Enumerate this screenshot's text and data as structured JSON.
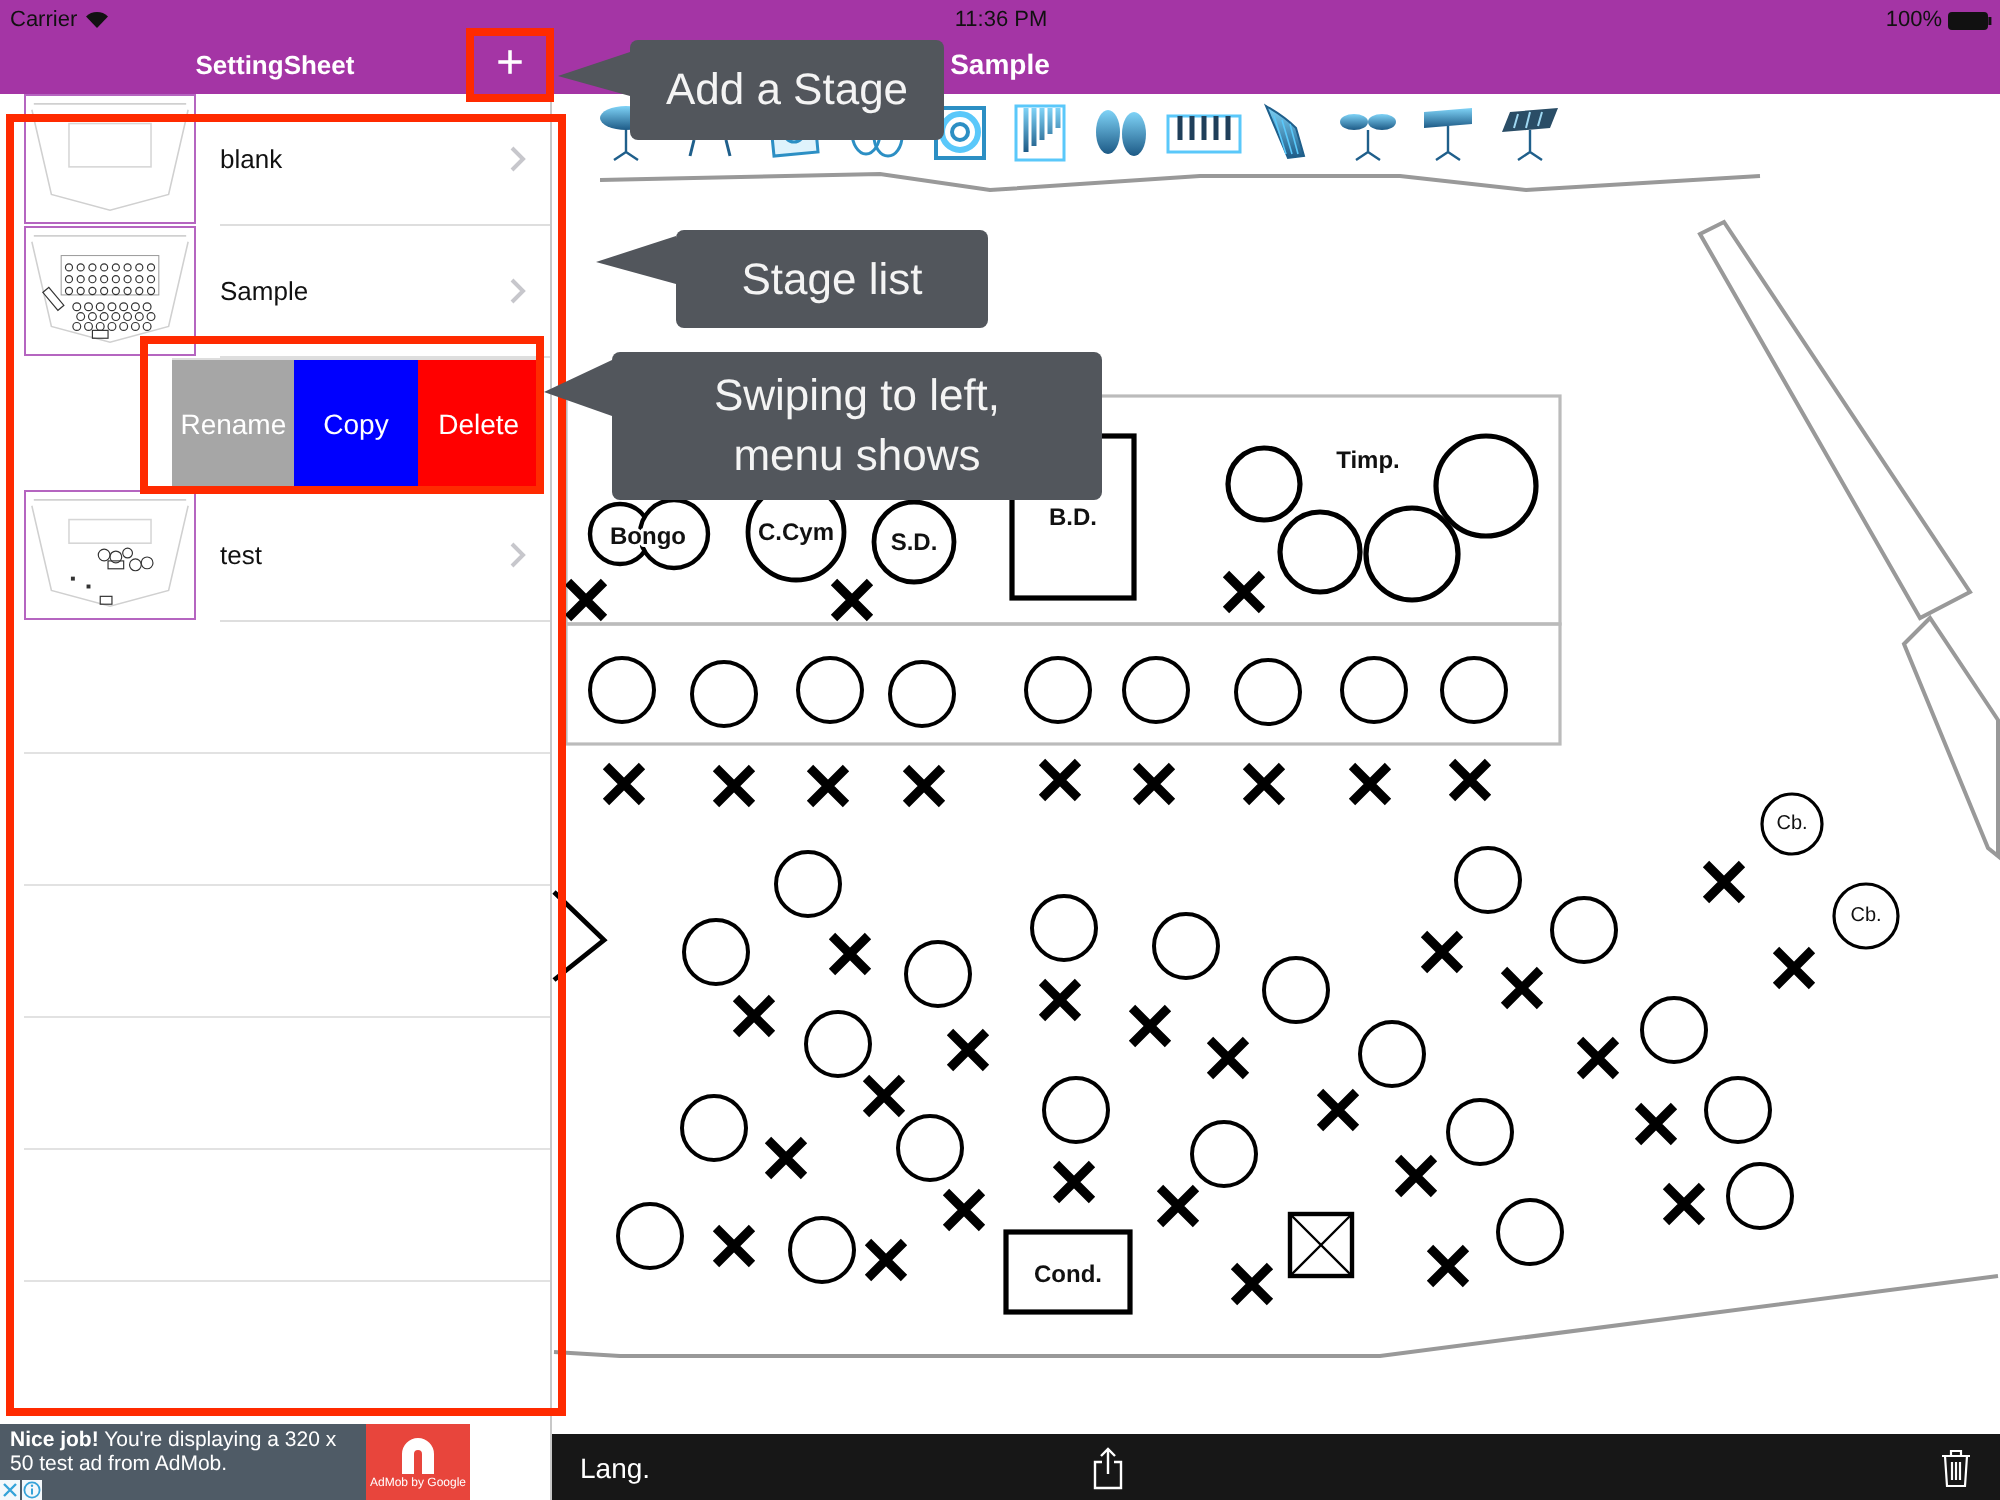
{
  "status_bar": {
    "carrier": "Carrier",
    "time": "11:36 PM",
    "battery": "100%"
  },
  "sidebar": {
    "title": "SettingSheet",
    "add_button": "+",
    "rows": [
      {
        "kind": "stage",
        "name": "blank",
        "thumbnail": {
          "kind": "empty"
        }
      },
      {
        "kind": "stage",
        "name": "Sample",
        "thumbnail": {
          "kind": "crowded"
        }
      },
      {
        "kind": "actions",
        "actions": [
          {
            "label": "Rename",
            "color": "#a6a6a6"
          },
          {
            "label": "Copy",
            "color": "#0000ff"
          },
          {
            "label": "Delete",
            "color": "#ff0000"
          }
        ]
      },
      {
        "kind": "stage",
        "name": "test",
        "thumbnail": {
          "kind": "sparse"
        }
      }
    ]
  },
  "ad": {
    "text": "**Nice job!** You're displaying a 320 x 50 test ad from AdMob.",
    "logo_caption": "AdMob by Google"
  },
  "stage": {
    "title": "Sample",
    "labels": [
      {
        "kind": "double-circle",
        "text": "Bongo"
      },
      {
        "kind": "circle",
        "text": "C.Cym"
      },
      {
        "kind": "circle",
        "text": "S.D."
      },
      {
        "kind": "square",
        "text": "B.D."
      },
      {
        "kind": "plain",
        "text": "Timp."
      },
      {
        "kind": "box",
        "text": "Cond."
      },
      {
        "kind": "small-circle",
        "text": "Cb."
      },
      {
        "kind": "small-circle",
        "text": "Cb."
      }
    ]
  },
  "toolbar": {
    "language_button": "Lang."
  },
  "callouts": [
    {
      "text": "Add a Stage"
    },
    {
      "text": "Stage list"
    },
    {
      "text": "Swiping to left, menu shows"
    }
  ]
}
